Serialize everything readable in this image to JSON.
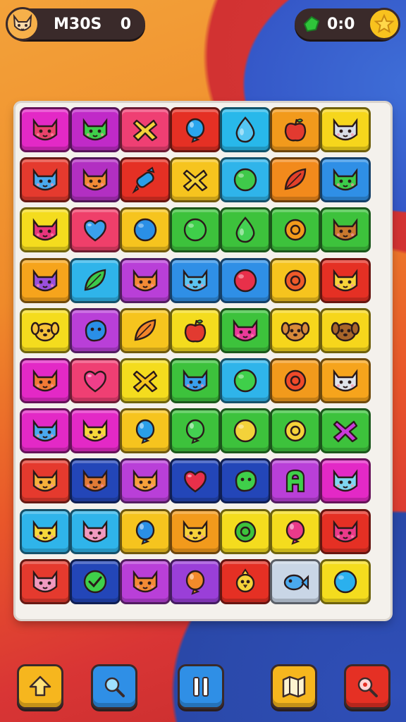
{
  "hud": {
    "left_label": "M30S",
    "left_value": "0",
    "right_value": "0:0",
    "avatar_icon": "fox-face-icon",
    "gem_icon": "green-gem-icon",
    "star_icon": "star-icon"
  },
  "board": {
    "rows": [
      [
        {
          "bg": "#e329c6",
          "icon": "cat",
          "fg": "#e8436a"
        },
        {
          "bg": "#c02ac8",
          "icon": "cat",
          "fg": "#3fcf4a"
        },
        {
          "bg": "#ef3f73",
          "icon": "cross",
          "fg": "#f3d23a"
        },
        {
          "bg": "#e53024",
          "icon": "balloon",
          "fg": "#2aa6ee"
        },
        {
          "bg": "#28b8ea",
          "icon": "drop",
          "fg": "#55c6f2"
        },
        {
          "bg": "#f29a1c",
          "icon": "apple",
          "fg": "#e23a30"
        },
        {
          "bg": "#f6d61c",
          "icon": "cat",
          "fg": "#d8dde6"
        }
      ],
      [
        {
          "bg": "#e53a2e",
          "icon": "cat",
          "fg": "#4aa9ee"
        },
        {
          "bg": "#b22fc2",
          "icon": "cat",
          "fg": "#f08a35"
        },
        {
          "bg": "#e53024",
          "icon": "candy",
          "fg": "#2a9ee8"
        },
        {
          "bg": "#f6c41e",
          "icon": "cross",
          "fg": "#f3d23a"
        },
        {
          "bg": "#2fb4ea",
          "icon": "circle",
          "fg": "#3fc94a"
        },
        {
          "bg": "#f28a1c",
          "icon": "leaf",
          "fg": "#e2402a"
        },
        {
          "bg": "#2f8fe6",
          "icon": "cat",
          "fg": "#3ccb4a"
        }
      ],
      [
        {
          "bg": "#f4dc1e",
          "icon": "cat",
          "fg": "#e8357c"
        },
        {
          "bg": "#ef3f6a",
          "icon": "heart",
          "fg": "#3aa0ec"
        },
        {
          "bg": "#f6c41e",
          "icon": "circle",
          "fg": "#2a8fe6"
        },
        {
          "bg": "#3dc23c",
          "icon": "circle",
          "fg": "#3fcf4a"
        },
        {
          "bg": "#3dc23c",
          "icon": "drop",
          "fg": "#44d052"
        },
        {
          "bg": "#3dc23c",
          "icon": "ring",
          "fg": "#f29a1c"
        },
        {
          "bg": "#3dc23c",
          "icon": "cat",
          "fg": "#c8782e"
        }
      ],
      [
        {
          "bg": "#f6a41c",
          "icon": "cat",
          "fg": "#9a4fdc"
        },
        {
          "bg": "#2fb4ea",
          "icon": "leaf",
          "fg": "#3cc94a"
        },
        {
          "bg": "#b93fd8",
          "icon": "cat",
          "fg": "#f28a35"
        },
        {
          "bg": "#2f8fe6",
          "icon": "cat",
          "fg": "#5cc4f0"
        },
        {
          "bg": "#2f8fe6",
          "icon": "circle",
          "fg": "#e8304a"
        },
        {
          "bg": "#f6c41e",
          "icon": "ring",
          "fg": "#ef5a2a"
        },
        {
          "bg": "#e53024",
          "icon": "cat",
          "fg": "#f7d33a"
        }
      ],
      [
        {
          "bg": "#f4dc1e",
          "icon": "dog",
          "fg": "#f6c23a"
        },
        {
          "bg": "#b93fd8",
          "icon": "blob",
          "fg": "#2a8fe6"
        },
        {
          "bg": "#f6c41e",
          "icon": "leaf",
          "fg": "#f2852a"
        },
        {
          "bg": "#f4dc1e",
          "icon": "apple",
          "fg": "#e23a30"
        },
        {
          "bg": "#3dc23c",
          "icon": "cat",
          "fg": "#ea3a9a"
        },
        {
          "bg": "#f6d61c",
          "icon": "dog",
          "fg": "#d88a3a"
        },
        {
          "bg": "#f6d61c",
          "icon": "dog",
          "fg": "#a8652a"
        }
      ],
      [
        {
          "bg": "#e329c6",
          "icon": "cat",
          "fg": "#f07a35"
        },
        {
          "bg": "#ef3f73",
          "icon": "heart",
          "fg": "#ef3f8a"
        },
        {
          "bg": "#f4dc1e",
          "icon": "cross",
          "fg": "#f6c41e"
        },
        {
          "bg": "#3dc23c",
          "icon": "cat",
          "fg": "#3a9fec"
        },
        {
          "bg": "#2fb4ea",
          "icon": "circle",
          "fg": "#3fcf4a"
        },
        {
          "bg": "#f29a1c",
          "icon": "ring",
          "fg": "#ef4a2a"
        },
        {
          "bg": "#f6a41c",
          "icon": "cat",
          "fg": "#dfe3ea"
        }
      ],
      [
        {
          "bg": "#e329c6",
          "icon": "cat",
          "fg": "#4aa9ee"
        },
        {
          "bg": "#e329c6",
          "icon": "cat",
          "fg": "#f6d83a"
        },
        {
          "bg": "#f6c41e",
          "icon": "balloon",
          "fg": "#2a9ee8"
        },
        {
          "bg": "#3dc23c",
          "icon": "balloon",
          "fg": "#44d052"
        },
        {
          "bg": "#3dc23c",
          "icon": "circle",
          "fg": "#f3d23a"
        },
        {
          "bg": "#3dc23c",
          "icon": "ring",
          "fg": "#f6d23a"
        },
        {
          "bg": "#3dc23c",
          "icon": "cross",
          "fg": "#c83ad8"
        }
      ],
      [
        {
          "bg": "#e53a2e",
          "icon": "cat",
          "fg": "#f6b03a"
        },
        {
          "bg": "#2346b8",
          "icon": "cat",
          "fg": "#e07a35"
        },
        {
          "bg": "#b93fd8",
          "icon": "cat",
          "fg": "#f6a03a"
        },
        {
          "bg": "#2346b8",
          "icon": "heart",
          "fg": "#e8304a"
        },
        {
          "bg": "#2346b8",
          "icon": "blob",
          "fg": "#3fcf4a"
        },
        {
          "bg": "#b93fd8",
          "icon": "letter",
          "fg": "#3fcf4a"
        },
        {
          "bg": "#e329c6",
          "icon": "cat",
          "fg": "#7fd6f0"
        }
      ],
      [
        {
          "bg": "#2fb4ea",
          "icon": "cat",
          "fg": "#f6d83a"
        },
        {
          "bg": "#2fb4ea",
          "icon": "cat",
          "fg": "#f09ac0"
        },
        {
          "bg": "#f6c41e",
          "icon": "balloon",
          "fg": "#2a8fe6"
        },
        {
          "bg": "#f29a1c",
          "icon": "cat",
          "fg": "#f6d23a"
        },
        {
          "bg": "#f4dc1e",
          "icon": "ring",
          "fg": "#3dc23c"
        },
        {
          "bg": "#f4dc1e",
          "icon": "balloon",
          "fg": "#ea3a8a"
        },
        {
          "bg": "#e53024",
          "icon": "cat",
          "fg": "#ea3a8a"
        }
      ],
      [
        {
          "bg": "#e53a2e",
          "icon": "cat",
          "fg": "#f09ac0"
        },
        {
          "bg": "#2346b8",
          "icon": "check",
          "fg": "#3fcf4a"
        },
        {
          "bg": "#b93fd8",
          "icon": "cat",
          "fg": "#f28a35"
        },
        {
          "bg": "#9a3fd8",
          "icon": "balloon",
          "fg": "#f28a2a"
        },
        {
          "bg": "#e53024",
          "icon": "chick",
          "fg": "#f6d23a"
        },
        {
          "bg": "#c9d6e6",
          "icon": "fish",
          "fg": "#4aa9ee"
        },
        {
          "bg": "#f4dc1e",
          "icon": "circle",
          "fg": "#2ab0ee"
        }
      ]
    ]
  },
  "toolbar": [
    {
      "name": "home-button",
      "icon": "home-arrow-icon",
      "bg": "#f6b61e"
    },
    {
      "name": "search-button",
      "icon": "magnifier-icon",
      "bg": "#2f8fe6"
    },
    {
      "name": "pause-button",
      "icon": "pause-icon",
      "bg": "#2f8fe6"
    },
    {
      "name": "map-button",
      "icon": "map-icon",
      "bg": "#f6b61e"
    },
    {
      "name": "hint-button",
      "icon": "magnifier-hint-icon",
      "bg": "#e53024"
    }
  ]
}
